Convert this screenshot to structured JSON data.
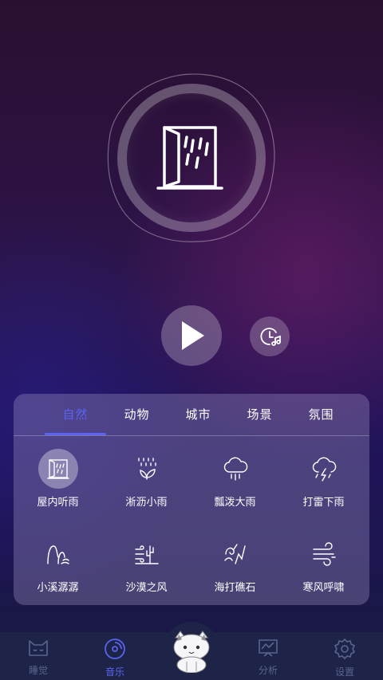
{
  "player": {
    "current_sound_icon": "window-rain-icon",
    "play_icon": "play-icon",
    "timer_icon": "timer-music-icon"
  },
  "tabs": [
    {
      "label": "自然",
      "active": true
    },
    {
      "label": "动物",
      "active": false
    },
    {
      "label": "城市",
      "active": false
    },
    {
      "label": "场景",
      "active": false
    },
    {
      "label": "氛围",
      "active": false
    }
  ],
  "sounds": [
    {
      "label": "屋内听雨",
      "icon": "window-rain-icon",
      "selected": true
    },
    {
      "label": "淅沥小雨",
      "icon": "drizzle-leaf-icon",
      "selected": false
    },
    {
      "label": "瓢泼大雨",
      "icon": "cloud-rain-icon",
      "selected": false
    },
    {
      "label": "打雷下雨",
      "icon": "thunderstorm-icon",
      "selected": false
    },
    {
      "label": "小溪潺潺",
      "icon": "stream-icon",
      "selected": false
    },
    {
      "label": "沙漠之风",
      "icon": "desert-wind-icon",
      "selected": false
    },
    {
      "label": "海打礁石",
      "icon": "wave-rock-icon",
      "selected": false
    },
    {
      "label": "寒风呼啸",
      "icon": "cold-wind-icon",
      "selected": false
    }
  ],
  "nav": [
    {
      "label": "睡觉",
      "icon": "sleep-cat-icon",
      "active": false
    },
    {
      "label": "音乐",
      "icon": "music-disc-icon",
      "active": true
    },
    {
      "label": "分析",
      "icon": "analysis-chart-icon",
      "active": false
    },
    {
      "label": "设置",
      "icon": "settings-gear-icon",
      "active": false
    }
  ],
  "colors": {
    "accent": "#5b63f0",
    "nav_inactive": "#5b6390",
    "nav_bg": "#1e2448"
  }
}
